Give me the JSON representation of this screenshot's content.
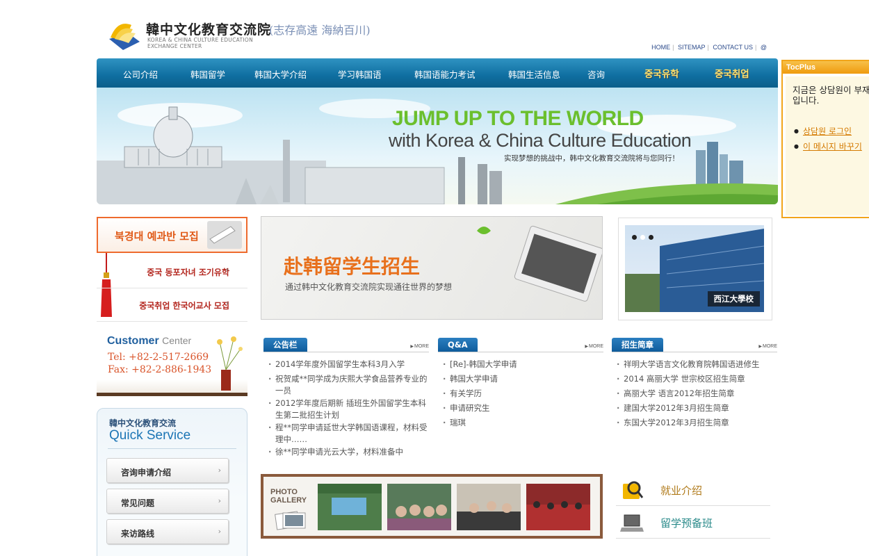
{
  "header": {
    "brand_name": "韓中文化教育交流院",
    "motto": "(志存高遠 海納百川)",
    "brand_en_line1": "KOREA & CHINA CULTURE EDUCATION",
    "brand_en_line2": "EXCHANGE CENTER",
    "top_links": [
      "HOME",
      "SITEMAP",
      "CONTACT US",
      "@"
    ]
  },
  "nav": {
    "items": [
      "公司介绍",
      "韩国留学",
      "韩国大学介绍",
      "学习韩国语",
      "韩国语能力考试",
      "韩国生活信息",
      "咨询"
    ],
    "kr_items": [
      "중국유학",
      "중국취업"
    ]
  },
  "banner": {
    "headline": "JUMP UP  TO THE WORLD",
    "subheadline": "with Korea & China Culture Education",
    "tagline": "实现梦想的挑战中，韩中文化教育交流院将与您同行！"
  },
  "tocplus": {
    "title": "TocPlus",
    "message": "지금은 상담원이 부재 중입니다.",
    "links": [
      "상담원 로그인",
      "이 메시지 바꾸기"
    ]
  },
  "left": {
    "promo_head": "북경대 예과반 모집",
    "promo_items": [
      "중국 동포자녀 조기유학",
      "중국취업 한국어교사 모집"
    ],
    "customer": {
      "title": "Customer",
      "title_suffix": "Center",
      "tel": "Tel:   +82-2-517-2669",
      "fax": "Fax:  +82-2-886-1943"
    },
    "quick": {
      "line1": "韓中文化教育交流",
      "line2": "Quick Service",
      "buttons": [
        "咨询申请介绍",
        "常见问题",
        "来访路线"
      ]
    }
  },
  "center_banner": {
    "title": "赴韩留学生招生",
    "subtitle": "通过韩中文化教育交流院实现通往世界的梦想"
  },
  "photo_card": {
    "caption": "西江大學校"
  },
  "boards": [
    {
      "tab": "公告栏",
      "more": "MORE",
      "items": [
        "2014学年度外国留学生本科3月入学",
        "祝贺咸**同学成为庆熙大学食品营养专业的一员",
        "2012学年度后期新 插班生外国留学生本科生第二批招生计划",
        "程**同学申请延世大学韩国语课程，材料受理中……",
        "徐**同学申请光云大学，材料准备中"
      ]
    },
    {
      "tab": "Q&A",
      "more": "MORE",
      "items": [
        "[Re]-韩国大学申请",
        "韩国大学申请",
        "有关学历",
        "申请研究生",
        "瑞琪"
      ]
    },
    {
      "tab": "招生简章",
      "more": "MORE",
      "items": [
        "祥明大学语言文化教育院韩国语进修生",
        "2014 高丽大学  世宗校区招生简章",
        "高丽大学  语言2012年招生简章",
        "建国大学2012年3月招生简章",
        "东国大学2012年3月招生简章"
      ]
    }
  ],
  "gallery": {
    "label_line1": "PHOTO",
    "label_line2": "GALLERY"
  },
  "right_links": [
    {
      "label": "就业介绍",
      "color": "#b07a1a"
    },
    {
      "label": "留学预备班",
      "color": "#2a8a8a"
    }
  ],
  "colors": {
    "nav_blue": "#0f6ea0",
    "accent_orange": "#e8701c",
    "tocplus_orange": "#f2a51a"
  }
}
